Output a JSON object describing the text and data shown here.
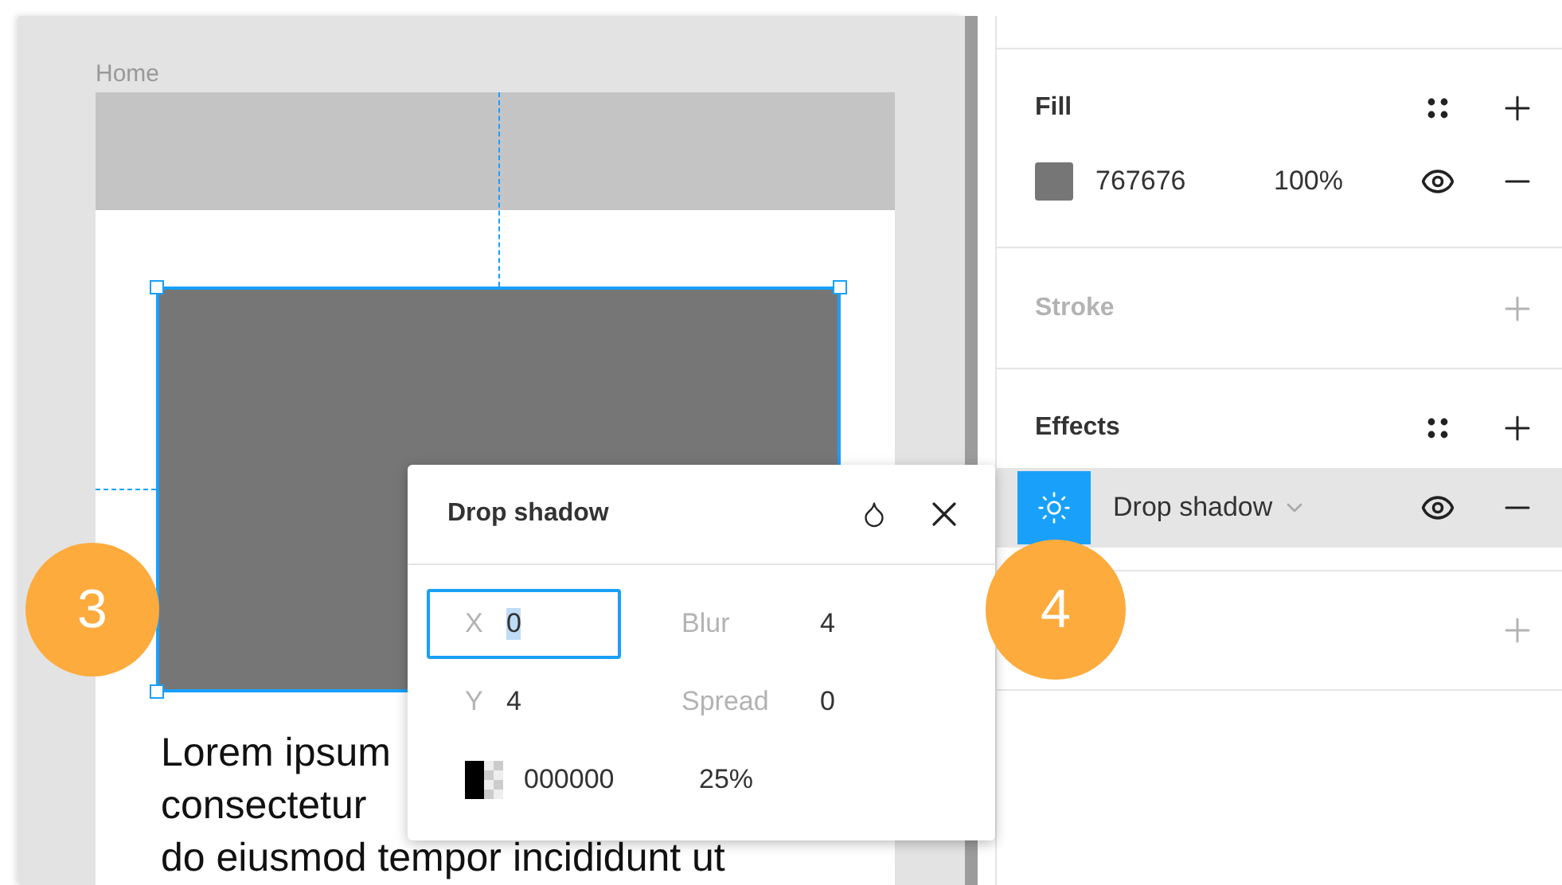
{
  "canvas": {
    "frame_label": "Home",
    "text_lines": [
      "Lorem ipsum",
      "consectetur",
      "do eiusmod tempor incididunt ut"
    ]
  },
  "fill": {
    "title": "Fill",
    "hex": "767676",
    "opacity": "100%",
    "visible": true
  },
  "stroke": {
    "title": "Stroke",
    "disabled": true
  },
  "effects": {
    "title": "Effects",
    "items": [
      {
        "label": "Drop shadow",
        "selected": true,
        "visible": true
      }
    ]
  },
  "popup": {
    "title": "Drop shadow",
    "fields": [
      {
        "label": "X",
        "value": "0",
        "focused": true
      },
      {
        "label": "Blur",
        "value": "4",
        "focused": false
      },
      {
        "label": "Y",
        "value": "4",
        "focused": false
      },
      {
        "label": "Spread",
        "value": "0",
        "focused": false
      }
    ],
    "color_hex": "000000",
    "color_opacity": "25%"
  },
  "badges": [
    "3",
    "4"
  ]
}
